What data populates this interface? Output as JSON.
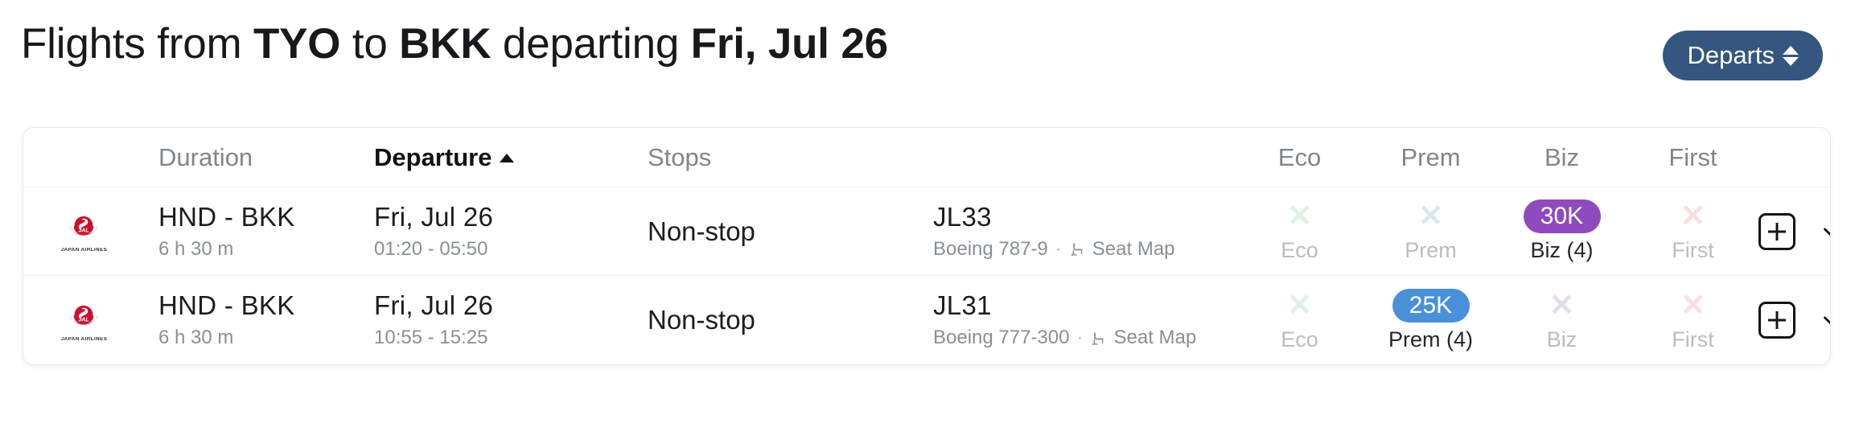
{
  "header": {
    "title_prefix": "Flights from ",
    "origin": "TYO",
    "title_mid": " to ",
    "destination": "BKK",
    "title_verb": " departing ",
    "date": "Fri, Jul 26",
    "sort_button_label": "Departs",
    "sort_button_color": "#34567f"
  },
  "table": {
    "headers": {
      "logo": "",
      "duration": "Duration",
      "departure": "Departure",
      "departure_sort": "ascending",
      "stops": "Stops",
      "flight": "",
      "eco": "Eco",
      "prem": "Prem",
      "biz": "Biz",
      "first": "First"
    },
    "rows": [
      {
        "airline": "Japan Airlines",
        "airline_code": "JAL",
        "airline_wordmark": "JAPAN AIRLINES",
        "route": "HND - BKK",
        "duration": "6 h 30 m",
        "departure_date": "Fri, Jul 26",
        "departure_times": "01:20 - 05:50",
        "stops": "Non-stop",
        "flight_number": "JL33",
        "aircraft": "Boeing 787-9",
        "separator": "·",
        "seat_map_label": "Seat Map",
        "cabins": [
          {
            "name": "eco",
            "label": "Eco",
            "available": false,
            "mark": "✕",
            "mark_color": "#dff0e4"
          },
          {
            "name": "prem",
            "label": "Prem",
            "available": false,
            "mark": "✕",
            "mark_color": "#d9e7f5"
          },
          {
            "name": "biz",
            "label": "Biz (4)",
            "available": true,
            "price": "30K",
            "pill_color": "#8f4bbd"
          },
          {
            "name": "first",
            "label": "First",
            "available": false,
            "mark": "✕",
            "mark_color": "#fadfe0"
          }
        ],
        "add_button_label": "+",
        "expand_button_label": "chevron-down"
      },
      {
        "airline": "Japan Airlines",
        "airline_code": "JAL",
        "airline_wordmark": "JAPAN AIRLINES",
        "route": "HND - BKK",
        "duration": "6 h 30 m",
        "departure_date": "Fri, Jul 26",
        "departure_times": "10:55 - 15:25",
        "stops": "Non-stop",
        "flight_number": "JL31",
        "aircraft": "Boeing 777-300",
        "separator": "·",
        "seat_map_label": "Seat Map",
        "cabins": [
          {
            "name": "eco",
            "label": "Eco",
            "available": false,
            "mark": "✕",
            "mark_color": "#dff0e4"
          },
          {
            "name": "prem",
            "label": "Prem (4)",
            "available": true,
            "price": "25K",
            "pill_color": "#4a90d9"
          },
          {
            "name": "biz",
            "label": "Biz",
            "available": false,
            "mark": "✕",
            "mark_color": "#e3dcee"
          },
          {
            "name": "first",
            "label": "First",
            "available": false,
            "mark": "✕",
            "mark_color": "#fadfe0"
          }
        ],
        "add_button_label": "+",
        "expand_button_label": "chevron-down"
      }
    ]
  }
}
